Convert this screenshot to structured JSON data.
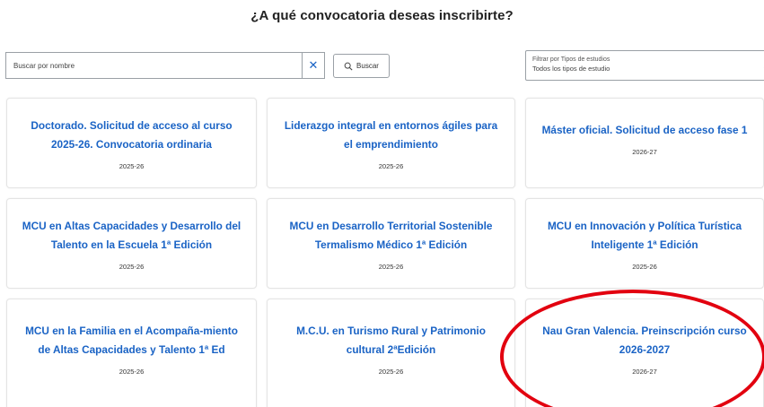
{
  "page": {
    "title": "¿A qué convocatoria deseas inscribirte?"
  },
  "search": {
    "placeholder": "Buscar por nombre",
    "clear_label": "✕",
    "button_label": "Buscar"
  },
  "filter": {
    "label": "Filtrar por Tipos de estudios",
    "value": "Todos los tipos de estudio",
    "chevron": "⌄"
  },
  "cards": [
    {
      "title": "Doctorado. Solicitud de acceso al curso 2025-26. Convocatoria ordinaria",
      "year": "2025-26"
    },
    {
      "title": "Liderazgo integral en entornos ágiles para el emprendimiento",
      "year": "2025-26"
    },
    {
      "title": "Máster oficial. Solicitud de acceso fase 1",
      "year": "2026-27"
    },
    {
      "title": "MCU en Altas Capacidades y Desarrollo del Talento en la Escuela 1ª Edición",
      "year": "2025-26"
    },
    {
      "title": "MCU en Desarrollo Territorial Sostenible Termalismo Médico 1ª Edición",
      "year": "2025-26"
    },
    {
      "title": "MCU en Innovación y Política Turística Inteligente 1ª Edición",
      "year": "2025-26"
    },
    {
      "title": "MCU en la Familia en el Acompaña-miento de Altas Capacidades y Talento 1ª Ed",
      "year": "2025-26"
    },
    {
      "title": "M.C.U. en Turismo Rural y Patrimonio cultural 2ªEdición",
      "year": "2025-26"
    },
    {
      "title": "Nau Gran Valencia. Preinscripción curso 2026-2027",
      "year": "2026-27"
    }
  ],
  "colors": {
    "link_blue": "#1a63c5",
    "highlight_red": "#e2000f"
  },
  "icons": {
    "clear": "close-icon",
    "search": "search-icon",
    "dropdown": "chevron-down-icon"
  }
}
